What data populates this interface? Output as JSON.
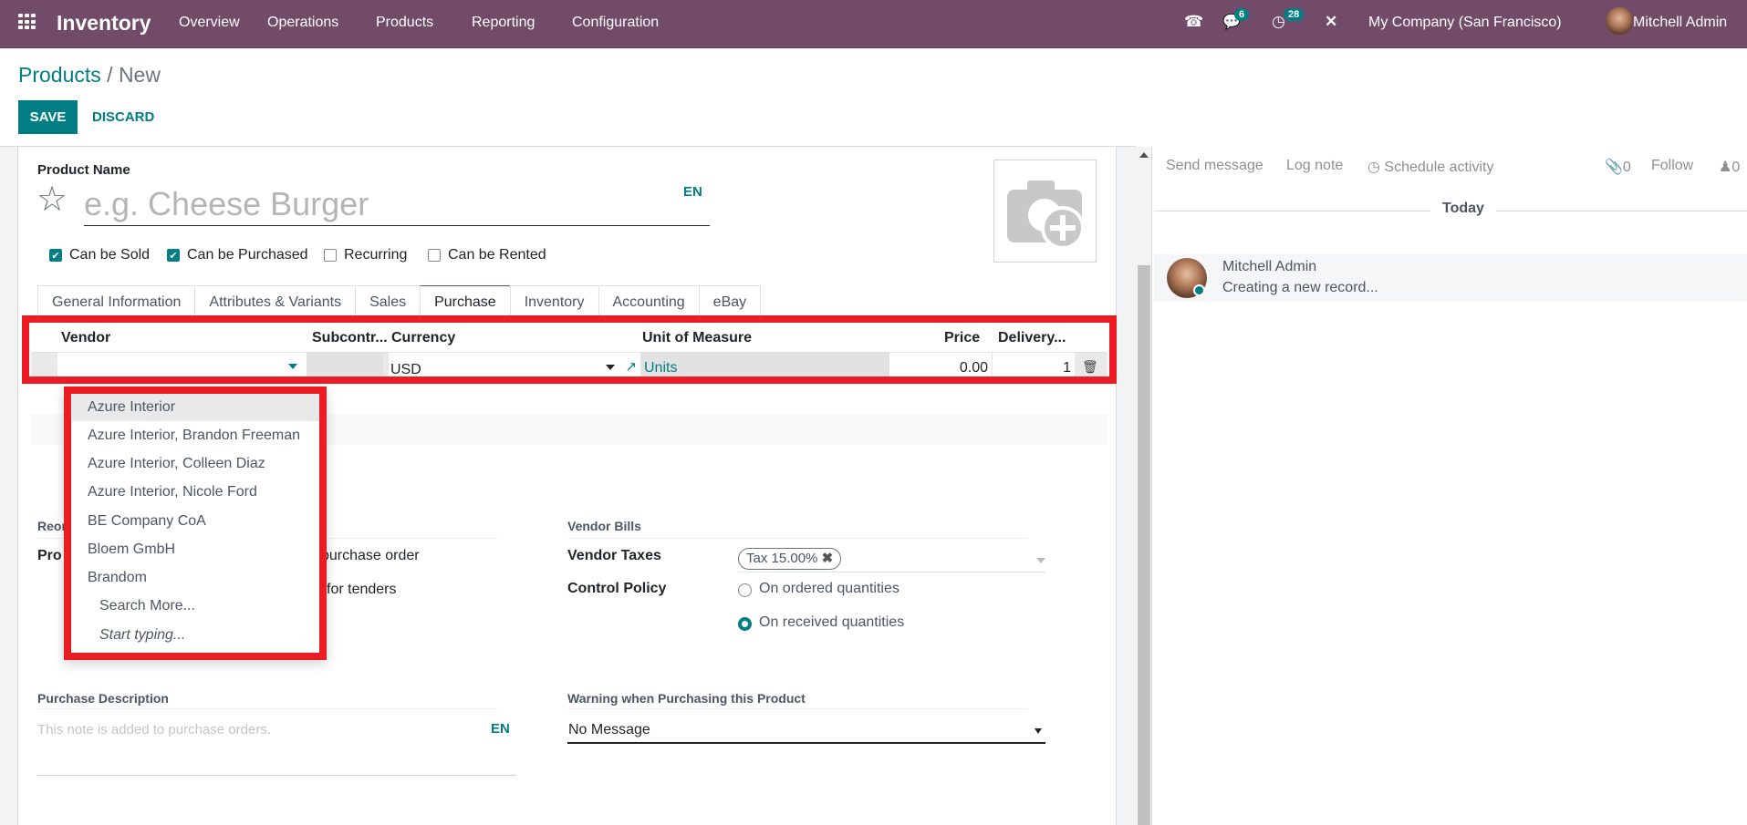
{
  "navbar": {
    "app_name": "Inventory",
    "menu": [
      "Overview",
      "Operations",
      "Products",
      "Reporting",
      "Configuration"
    ],
    "messages_count": "6",
    "activities_count": "28",
    "company": "My Company (San Francisco)",
    "user": "Mitchell Admin",
    "color": "#714B67"
  },
  "breadcrumb": {
    "parent": "Products",
    "separator": "/",
    "current": "New"
  },
  "control": {
    "save": "SAVE",
    "discard": "DISCARD"
  },
  "form": {
    "product_name_label": "Product Name",
    "product_name_placeholder": "e.g. Cheese Burger",
    "lang": "EN",
    "checkboxes": [
      {
        "label": "Can be Sold",
        "checked": true
      },
      {
        "label": "Can be Purchased",
        "checked": true
      },
      {
        "label": "Recurring",
        "checked": false
      },
      {
        "label": "Can be Rented",
        "checked": false
      }
    ],
    "tabs": [
      "General Information",
      "Attributes & Variants",
      "Sales",
      "Purchase",
      "Inventory",
      "Accounting",
      "eBay"
    ],
    "active_tab": "Purchase",
    "vendor_table": {
      "headers": [
        "Vendor",
        "Subcontr...",
        "Currency",
        "Unit of Measure",
        "Price",
        "Delivery..."
      ],
      "row": {
        "vendor": "",
        "subcontractor": "",
        "currency": "USD",
        "uom": "Units",
        "price": "0.00",
        "delivery": "1"
      }
    },
    "vendor_dropdown": {
      "options": [
        "Azure Interior",
        "Azure Interior, Brandon Freeman",
        "Azure Interior, Colleen Diaz",
        "Azure Interior, Nicole Ford",
        "BE Company CoA",
        "Bloem GmbH",
        "Brandom"
      ],
      "search_more": "Search More...",
      "start_typing": "Start typing..."
    },
    "reordering": {
      "section_partial": "Reor",
      "label_partial": "Pro",
      "text1_partial": "purchase order",
      "text2_partial": "for tenders"
    },
    "vendor_bills": {
      "section": "Vendor Bills",
      "vendor_taxes_label": "Vendor Taxes",
      "vendor_tax_tag": "Tax 15.00%",
      "control_policy_label": "Control Policy",
      "options": [
        {
          "label": "On ordered quantities",
          "selected": false
        },
        {
          "label": "On received quantities",
          "selected": true
        }
      ]
    },
    "purchase_description": {
      "section": "Purchase Description",
      "placeholder": "This note is added to purchase orders.",
      "lang": "EN"
    },
    "warning": {
      "section": "Warning when Purchasing this Product",
      "value": "No Message"
    }
  },
  "chatter": {
    "send_message": "Send message",
    "log_note": "Log note",
    "schedule_activity": "Schedule activity",
    "attachments": "0",
    "follow": "Follow",
    "followers": "0",
    "date_separator": "Today",
    "message": {
      "author": "Mitchell Admin",
      "body": "Creating a new record..."
    }
  }
}
